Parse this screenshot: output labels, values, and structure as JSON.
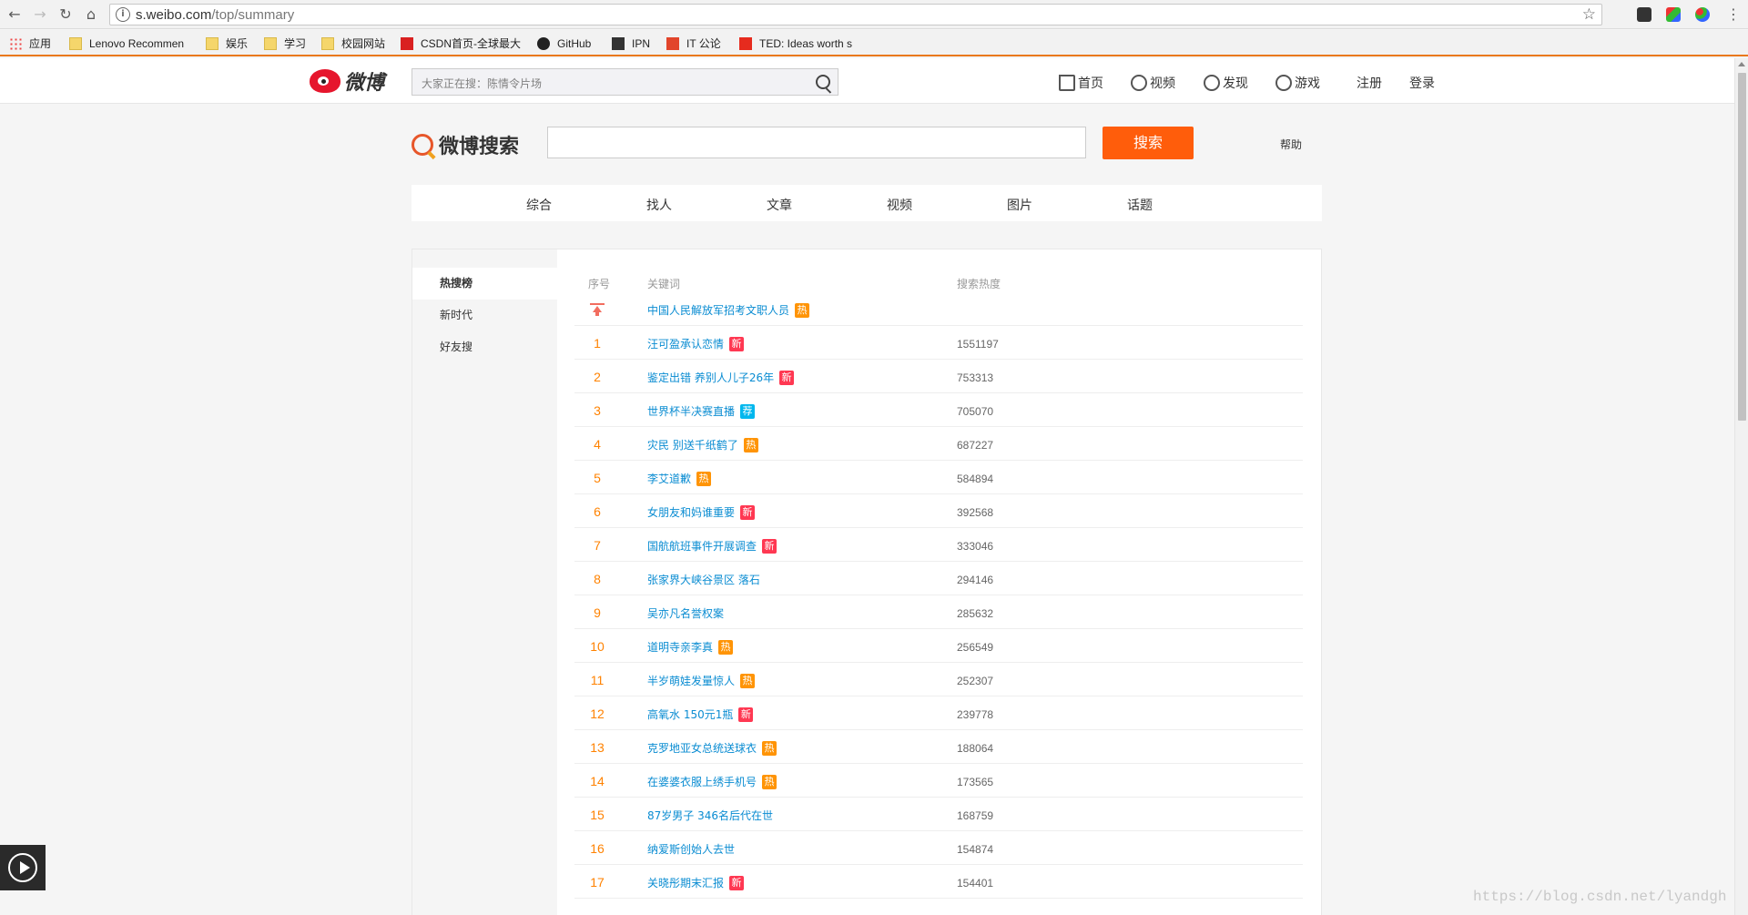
{
  "browser": {
    "url_host": "s.weibo.com",
    "url_path": "/top/summary",
    "bookmarks": [
      {
        "label": "应用",
        "icon": "apps-icon"
      },
      {
        "label": "Lenovo Recommen",
        "icon": "folder-icon"
      },
      {
        "label": "娱乐",
        "icon": "folder-icon"
      },
      {
        "label": "学习",
        "icon": "folder-icon"
      },
      {
        "label": "校园网站",
        "icon": "folder-icon"
      },
      {
        "label": "CSDN首页-全球最大",
        "icon": "csdn-icon"
      },
      {
        "label": "GitHub",
        "icon": "github-icon"
      },
      {
        "label": "IPN",
        "icon": "ipn-icon"
      },
      {
        "label": "IT 公论",
        "icon": "itgonglun-icon"
      },
      {
        "label": "TED: Ideas worth s",
        "icon": "ted-icon"
      }
    ]
  },
  "header": {
    "logo_text": "微博",
    "search_placeholder": "大家正在搜：陈情令片场",
    "nav": [
      "首页",
      "视频",
      "发现",
      "游戏",
      "注册",
      "登录"
    ]
  },
  "search": {
    "title": "微博搜索",
    "button": "搜索",
    "help": "帮助",
    "tabs": [
      "综合",
      "找人",
      "文章",
      "视频",
      "图片",
      "话题"
    ]
  },
  "sidebar": {
    "items": [
      "热搜榜",
      "新时代",
      "好友搜"
    ]
  },
  "table": {
    "headers": {
      "rank": "序号",
      "keyword": "关键词",
      "heat": "搜索热度"
    },
    "rows": [
      {
        "rank": "",
        "keyword": "中国人民解放军招考文职人员",
        "tag": "热",
        "heat": ""
      },
      {
        "rank": "1",
        "keyword": "汪可盈承认恋情",
        "tag": "新",
        "heat": "1551197"
      },
      {
        "rank": "2",
        "keyword": "鉴定出错 养别人儿子26年",
        "tag": "新",
        "heat": "753313"
      },
      {
        "rank": "3",
        "keyword": "世界杯半决赛直播",
        "tag": "荐",
        "heat": "705070"
      },
      {
        "rank": "4",
        "keyword": "灾民 别送千纸鹤了",
        "tag": "热",
        "heat": "687227"
      },
      {
        "rank": "5",
        "keyword": "李艾道歉",
        "tag": "热",
        "heat": "584894"
      },
      {
        "rank": "6",
        "keyword": "女朋友和妈谁重要",
        "tag": "新",
        "heat": "392568"
      },
      {
        "rank": "7",
        "keyword": "国航航班事件开展调查",
        "tag": "新",
        "heat": "333046"
      },
      {
        "rank": "8",
        "keyword": "张家界大峡谷景区 落石",
        "tag": "",
        "heat": "294146"
      },
      {
        "rank": "9",
        "keyword": "吴亦凡名誉权案",
        "tag": "",
        "heat": "285632"
      },
      {
        "rank": "10",
        "keyword": "道明寺亲李真",
        "tag": "热",
        "heat": "256549"
      },
      {
        "rank": "11",
        "keyword": "半岁萌娃发量惊人",
        "tag": "热",
        "heat": "252307"
      },
      {
        "rank": "12",
        "keyword": "高氧水 150元1瓶",
        "tag": "新",
        "heat": "239778"
      },
      {
        "rank": "13",
        "keyword": "克罗地亚女总统送球衣",
        "tag": "热",
        "heat": "188064"
      },
      {
        "rank": "14",
        "keyword": "在婆婆衣服上绣手机号",
        "tag": "热",
        "heat": "173565"
      },
      {
        "rank": "15",
        "keyword": "87岁男子 346名后代在世",
        "tag": "",
        "heat": "168759"
      },
      {
        "rank": "16",
        "keyword": "纳爱斯创始人去世",
        "tag": "",
        "heat": "154874"
      },
      {
        "rank": "17",
        "keyword": "关晓彤期末汇报",
        "tag": "新",
        "heat": "154401"
      }
    ]
  },
  "tag_colors": {
    "热": "#ff9406",
    "新": "#ff3852",
    "荐": "#00b7ee"
  },
  "watermark": "https://blog.csdn.net/lyandgh"
}
